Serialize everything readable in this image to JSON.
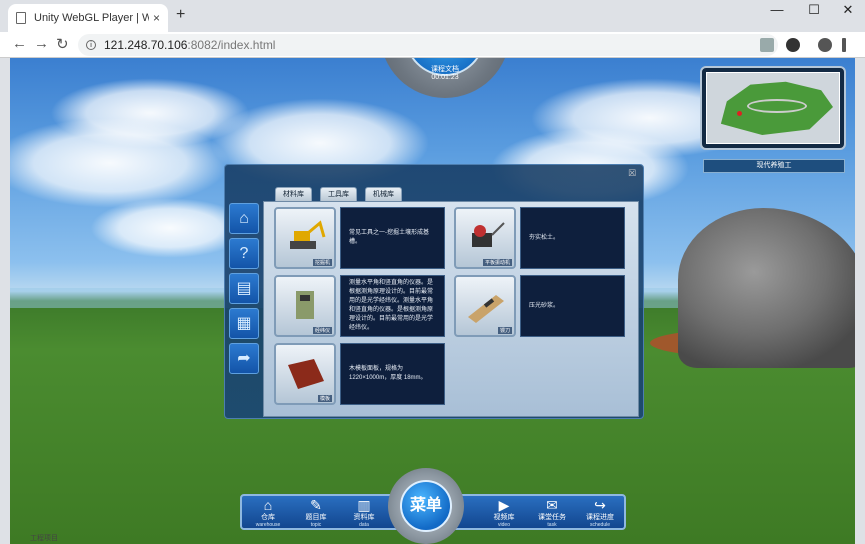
{
  "browser": {
    "tab_title": "Unity WebGL Player | WtScript",
    "tab_close": "×",
    "new_tab": "+",
    "url_host": "121.248.70.106",
    "url_path": ":8082/index.html",
    "minimize": "—",
    "maximize": "☐",
    "close": "✕",
    "back": "←",
    "forward": "→",
    "reload": "↻"
  },
  "hud": {
    "top_gear_title": "课程文档",
    "top_gear_time": "00:01:23",
    "map_label": "现代养殖工"
  },
  "dialog": {
    "close": "☒",
    "tabs": [
      "材料库",
      "工具库",
      "机械库"
    ],
    "sidebar_icons": [
      "home-icon",
      "help-icon",
      "book-icon",
      "film-icon",
      "share-icon"
    ],
    "items": [
      {
        "caption": "挖掘机",
        "desc": "常见工具之一-挖掘土壤形成基槽。"
      },
      {
        "caption": "平板振动机",
        "desc": "夯实松土。"
      },
      {
        "caption": "经纬仪",
        "desc": "测量水平角和竖直角的仪器。是根据测角原理设计的。目前最常用的是光学经纬仪。测量水平角和竖直角的仪器。是根据测角原理设计的。目前最常用的是光学经纬仪。"
      },
      {
        "caption": "镘刀",
        "desc": "压光砂浆。"
      },
      {
        "caption": "模板",
        "desc": "木模板面板，规格为 1220×1000m，厚度 18mm。"
      }
    ]
  },
  "menu": {
    "center": "菜单",
    "items": [
      {
        "zh": "仓库",
        "en": "warehouse",
        "icon": "⌂"
      },
      {
        "zh": "题目库",
        "en": "topic",
        "icon": "✎"
      },
      {
        "zh": "资料库",
        "en": "data",
        "icon": "▥"
      },
      {
        "zh": "视频库",
        "en": "video",
        "icon": "▶"
      },
      {
        "zh": "课堂任务",
        "en": "task",
        "icon": "✉"
      },
      {
        "zh": "课程进度",
        "en": "schedule",
        "icon": "↪"
      }
    ]
  },
  "status_fragment": "工程项目"
}
